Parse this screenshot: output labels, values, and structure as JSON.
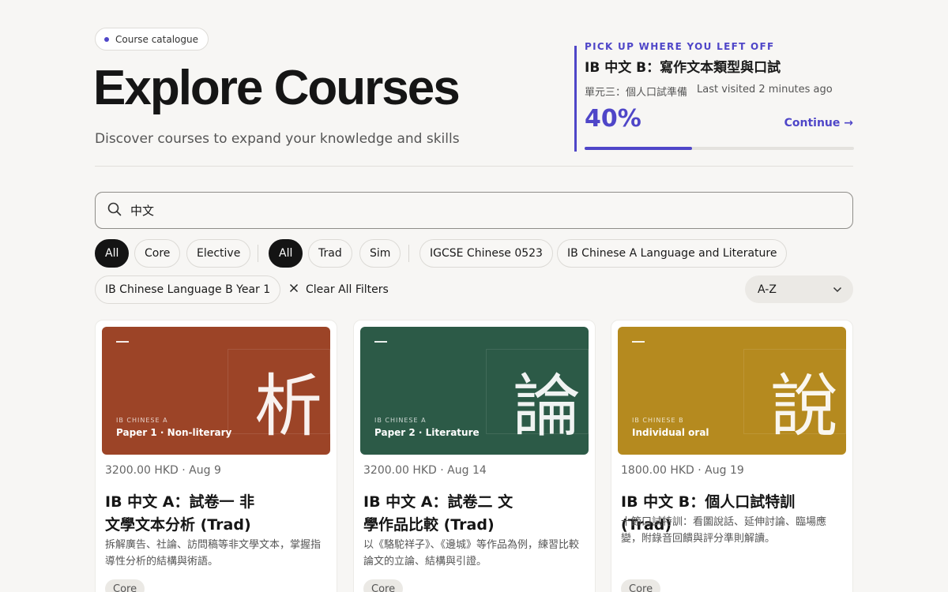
{
  "header": {
    "badge": "Course catalogue",
    "title": "Explore Courses",
    "subtitle": "Discover courses to expand your knowledge and skills"
  },
  "resume": {
    "eyebrow": "PICK UP WHERE YOU LEFT OFF",
    "course_title": "IB 中文 B：寫作文本類型與口試",
    "unit": "單元三：個人口試準備",
    "last_visited": "Last visited 2 minutes ago",
    "percent_label": "40%",
    "progress_fraction": 0.4,
    "continue_label": "Continue →",
    "accent": "#4f46c8"
  },
  "search": {
    "value": "中文",
    "icon": "search-icon"
  },
  "filters": {
    "type": [
      "All",
      "Core",
      "Elective"
    ],
    "script": [
      "All",
      "Trad",
      "Sim"
    ],
    "programs": [
      "IGCSE Chinese 0523",
      "IB Chinese A Language and Literature",
      "IB Chinese Language B Year 1"
    ],
    "clear_label": "Clear All Filters",
    "sort_value": "A-Z"
  },
  "courses": [
    {
      "cover_color": "#9c4427",
      "glyph": "析",
      "eyebrow": "IB CHINESE A",
      "cover_label": "Paper 1 · Non-literary",
      "price_date": "3200.00 HKD · Aug 9",
      "title": "IB 中文 A：試卷一 非文學文本分析 (Trad)",
      "description": "拆解廣告、社論、訪問稿等非文學文本，掌握指導性分析的結構與術語。",
      "tag": "Core"
    },
    {
      "cover_color": "#2c5a47",
      "glyph": "論",
      "eyebrow": "IB CHINESE A",
      "cover_label": "Paper 2 · Literature",
      "price_date": "3200.00 HKD · Aug 14",
      "title": "IB 中文 A：試卷二 文學作品比較 (Trad)",
      "description": "以《駱駝祥子》、《邊城》等作品為例，練習比較論文的立論、結構與引證。",
      "tag": "Core"
    },
    {
      "cover_color": "#b58a1f",
      "glyph": "說",
      "eyebrow": "IB CHINESE B",
      "cover_label": "Individual oral",
      "price_date": "1800.00 HKD · Aug 19",
      "title": "IB 中文 B：個人口試特訓 (Trad)",
      "description": "十節口試特訓：看圖說話、延伸討論、臨場應變，附錄音回饋與評分準則解讀。",
      "tag": "Core"
    }
  ]
}
